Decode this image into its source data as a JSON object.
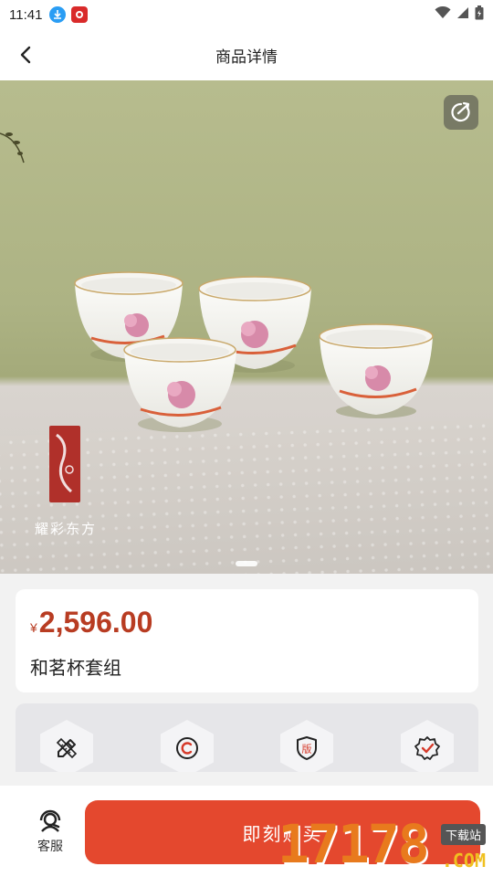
{
  "status_bar": {
    "time": "11:41",
    "icons": [
      "download-icon",
      "app-badge-icon",
      "wifi-icon",
      "signal-icon",
      "battery-icon"
    ]
  },
  "nav": {
    "title": "商品详情",
    "back_icon": "chevron-left-icon"
  },
  "hero": {
    "brand_text": "耀彩东方",
    "share_icon": "share-icon",
    "dots_total": 1,
    "dot_active": 1
  },
  "product": {
    "currency": "¥",
    "price": "2,596.00",
    "name": "和茗杯套组",
    "price_color": "#b83c22"
  },
  "features": [
    {
      "icon": "design-pencil-ruler-icon"
    },
    {
      "icon": "copyright-icon"
    },
    {
      "icon": "copyright-shield-icon",
      "label": "版"
    },
    {
      "icon": "verified-badge-icon"
    }
  ],
  "bottom_bar": {
    "service_label": "客服",
    "service_icon": "customer-service-icon",
    "buy_label": "即刻购买",
    "buy_color": "#e4482e"
  },
  "watermark": {
    "number": "17178",
    "tag": "下载站",
    "suffix": ".COM"
  }
}
